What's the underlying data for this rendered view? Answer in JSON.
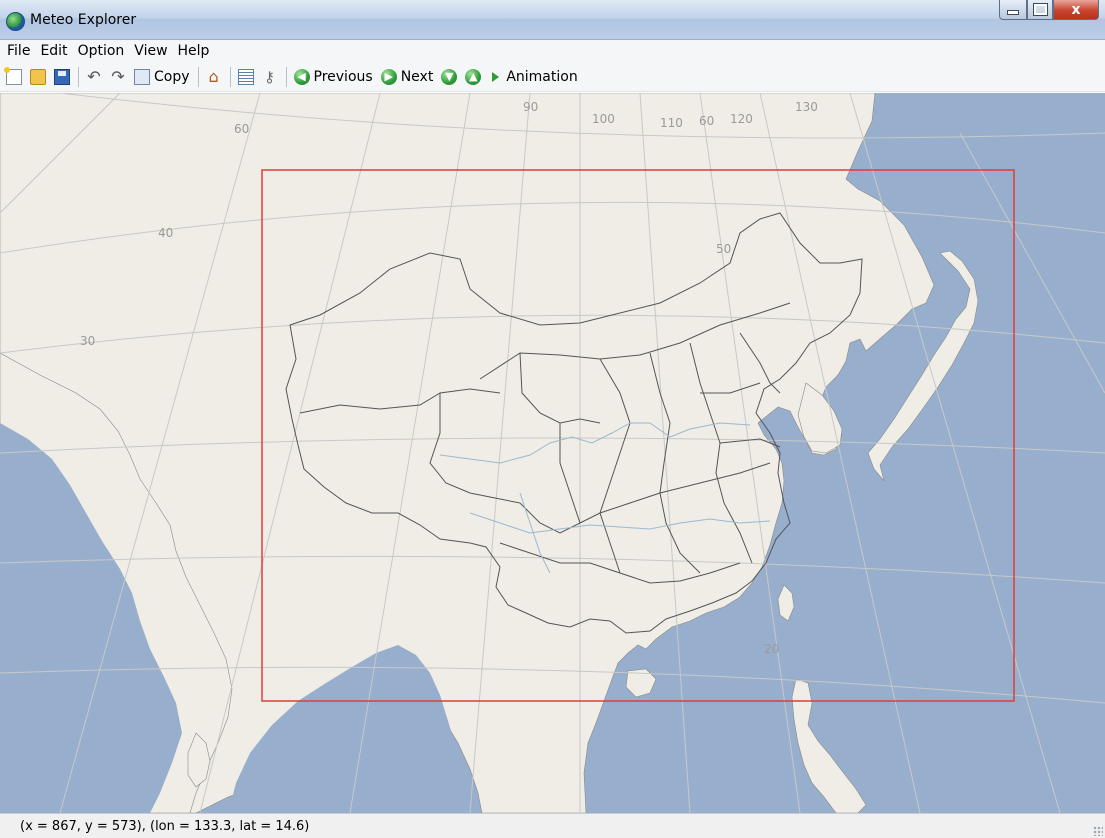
{
  "window": {
    "title": "Meteo Explorer",
    "close_glyph": "x"
  },
  "menu": [
    "File",
    "Edit",
    "Option",
    "View",
    "Help"
  ],
  "toolbar": {
    "copy_label": "Copy",
    "previous_label": "Previous",
    "next_label": "Next",
    "animation_label": "Animation"
  },
  "map": {
    "lon_labels": [
      "90",
      "100",
      "110",
      "120",
      "130"
    ],
    "lat_labels": [
      "60",
      "50",
      "40",
      "30",
      "20"
    ],
    "upper_lat_label": "60",
    "colors": {
      "ocean": "#97afcc",
      "land": "#efede6",
      "border": "#555555",
      "grid": "#c8c8c8",
      "river": "#9ab8d4",
      "extent_box": "#e23b3b"
    }
  },
  "status": {
    "text": "(x = 867, y = 573), (lon = 133.3, lat = 14.6)"
  }
}
